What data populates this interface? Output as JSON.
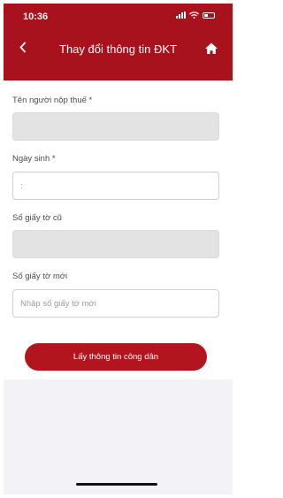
{
  "status_bar": {
    "time": "10:36"
  },
  "header": {
    "title": "Thay đổi thông tin ĐKT"
  },
  "form": {
    "taxpayer_name_label": "Tên người nộp thuế *",
    "taxpayer_name_value": "",
    "dob_label": "Ngày sinh *",
    "dob_value": ":",
    "old_id_label": "Số giấy tờ cũ",
    "old_id_value": "",
    "new_id_label": "Số giấy tờ mới",
    "new_id_placeholder": "Nhập số giấy tờ mới"
  },
  "actions": {
    "submit_label": "Lấy thông tin công dân"
  },
  "colors": {
    "brand": "#a8121c",
    "button": "#b3151e",
    "disabled_field": "#e3e3e3",
    "background": "#f2f2f7"
  }
}
